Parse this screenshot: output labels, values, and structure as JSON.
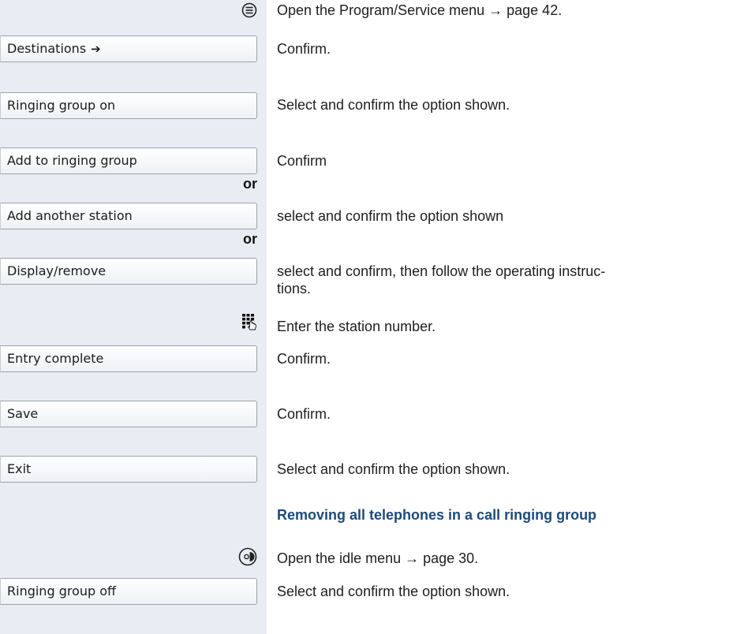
{
  "rows": [
    {
      "desc_pre": "Open the Program/Service menu ",
      "arrow": "→",
      "desc_post": " page 42.",
      "icon": "menu-circle-icon"
    },
    {
      "button": "Destinations",
      "button_arrow": "➔",
      "desc": "Confirm."
    },
    {
      "button": "Ringing group on",
      "desc": "Select and confirm the option shown."
    },
    {
      "button": "Add to ringing group",
      "desc": "Confirm"
    },
    {
      "or": "or"
    },
    {
      "button": "Add another station",
      "desc": "select and confirm the option shown"
    },
    {
      "or": "or"
    },
    {
      "button": "Display/remove",
      "desc_line1": "select and confirm, then follow the operating instruc-",
      "desc_line2": "tions."
    },
    {
      "desc": "Enter the station number.",
      "icon": "keypad-icon"
    },
    {
      "button": "Entry complete",
      "desc": "Confirm."
    },
    {
      "button": "Save",
      "desc": "Confirm."
    },
    {
      "button": "Exit",
      "desc": "Select and confirm the option shown."
    }
  ],
  "section_heading": "Removing all telephones in a call ringing group",
  "idle": {
    "desc_pre": "Open the idle menu ",
    "arrow": "→",
    "desc_post": " page 30.",
    "icon": "idle-menu-icon"
  },
  "last": {
    "button": "Ringing group off",
    "desc": "Select and confirm the option shown."
  }
}
